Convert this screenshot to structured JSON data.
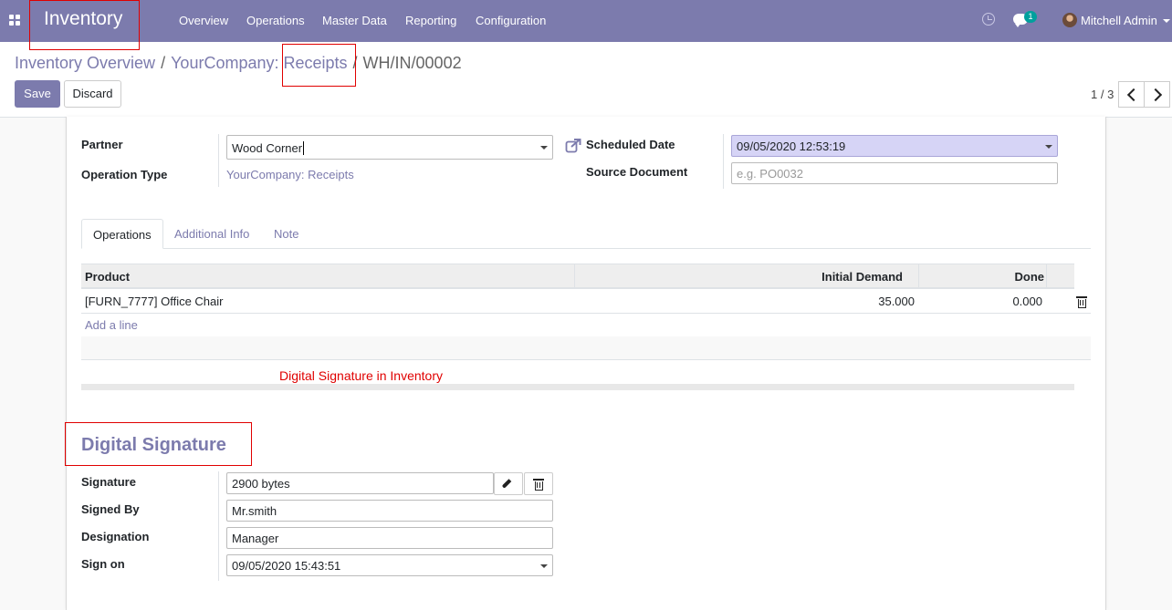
{
  "nav": {
    "brand": "Inventory",
    "menu": [
      "Overview",
      "Operations",
      "Master Data",
      "Reporting",
      "Configuration"
    ],
    "messages_badge": "1",
    "user": "Mitchell Admin"
  },
  "breadcrumb": {
    "items": [
      "Inventory Overview",
      "YourCompany: Receipts",
      "WH/IN/00002"
    ]
  },
  "toolbar": {
    "save_label": "Save",
    "discard_label": "Discard",
    "pager": "1 / 3"
  },
  "form": {
    "partner_label": "Partner",
    "partner_value": "Wood Corner",
    "operation_type_label": "Operation Type",
    "operation_type_value": "YourCompany: Receipts",
    "scheduled_date_label": "Scheduled Date",
    "scheduled_date_value": "09/05/2020 12:53:19",
    "source_document_label": "Source Document",
    "source_document_placeholder": "e.g. PO0032"
  },
  "tabs": [
    "Operations",
    "Additional Info",
    "Note"
  ],
  "table": {
    "columns": [
      "Product",
      "Initial Demand",
      "Done"
    ],
    "rows": [
      {
        "product": "[FURN_7777] Office Chair",
        "initial_demand": "35.000",
        "done": "0.000"
      }
    ],
    "add_line": "Add a line"
  },
  "annotation": "Digital Signature in Inventory",
  "signature_section": {
    "title": "Digital Signature",
    "signature_label": "Signature",
    "signature_value": "2900 bytes",
    "signed_by_label": "Signed By",
    "signed_by_value": "Mr.smith",
    "designation_label": "Designation",
    "designation_value": "Manager",
    "sign_on_label": "Sign on",
    "sign_on_value": "09/05/2020 15:43:51"
  },
  "colors": {
    "brand": "#7c7bad",
    "annotation_red": "#e00000",
    "badge": "#00a09d"
  }
}
